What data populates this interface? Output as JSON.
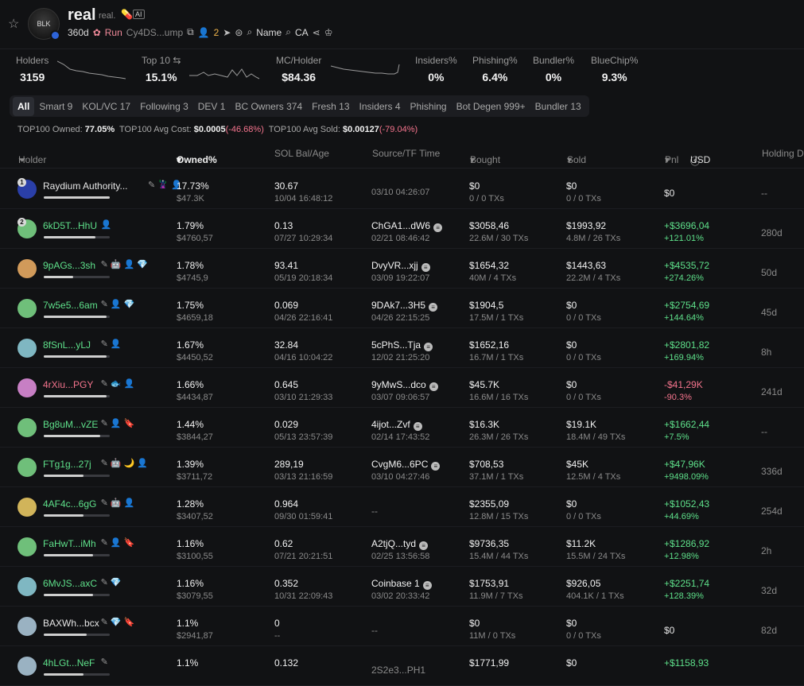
{
  "header": {
    "name": "real",
    "sub": "real.",
    "ai_badge": "AI",
    "age": "360d",
    "run": "Run",
    "ca": "Cy4DS...ump",
    "holders_count": "2",
    "name_label": "Name",
    "ca_label": "CA"
  },
  "stats": [
    {
      "label": "Holders",
      "value": "3159"
    },
    {
      "label": "Top 10",
      "value": "15.1%"
    },
    {
      "label": "MC/Holder",
      "value": "$84.36"
    },
    {
      "label": "Insiders%",
      "value": "0%"
    },
    {
      "label": "Phishing%",
      "value": "6.4%"
    },
    {
      "label": "Bundler%",
      "value": "0%"
    },
    {
      "label": "BlueChip%",
      "value": "9.3%"
    }
  ],
  "tabs": [
    "All",
    "Smart 9",
    "KOL/VC 17",
    "Following 3",
    "DEV 1",
    "BC Owners 374",
    "Fresh 13",
    "Insiders 4",
    "Phishing",
    "Bot Degen 999+",
    "Bundler 13"
  ],
  "summary": {
    "owned_label": "TOP100 Owned:",
    "owned": "77.05%",
    "cost_label": "TOP100 Avg Cost:",
    "cost": "$0.0005",
    "cost_chg": "(-46.68%)",
    "sold_label": "TOP100 Avg Sold:",
    "sold": "$0.00127",
    "sold_chg": "(-79.04%)"
  },
  "columns": {
    "holder": "Holder",
    "owned": "Owned%",
    "sol": "SOL Bal/Age",
    "source": "Source/TF Time",
    "bought": "Bought",
    "sold": "Sold",
    "pnl": "Pnl",
    "usd": "USD",
    "holding": "Holding Du"
  },
  "colors": {
    "green": "#5ee08a",
    "red": "#f4748d",
    "bg": "#111214"
  },
  "rows": [
    {
      "rank": "1",
      "name": "Raydium Authority...",
      "name_color": "w",
      "bar": 1.0,
      "avatar": "#2a3fa8",
      "badges": "✎ 🦹 👤",
      "owned": "17.73%",
      "owned_usd": "$47.3K",
      "sol": "30.67",
      "age": "10/04 16:48:12",
      "source": "",
      "src_time": "03/10 04:26:07",
      "bought": "$0",
      "bought_tx": "0 / 0 TXs",
      "sold": "$0",
      "sold_tx": "0 / 0 TXs",
      "pnl": "$0",
      "pnl_pct": "",
      "pnl_color": "w",
      "hold": "--"
    },
    {
      "rank": "2",
      "name": "6kD5T...HhU",
      "name_color": "g",
      "bar": 0.78,
      "avatar": "#6fbf7a",
      "badges": "👤",
      "owned": "1.79%",
      "owned_usd": "$4760,57",
      "sol": "0.13",
      "age": "07/27 10:29:34",
      "source": "ChGA1...dW6",
      "src_time": "02/21 08:46:42",
      "bought": "$3058,46",
      "bought_tx": "22.6M / 30 TXs",
      "sold": "$1993,92",
      "sold_tx": "4.8M / 26 TXs",
      "pnl": "+$3696,04",
      "pnl_pct": "+121.01%",
      "pnl_color": "g",
      "hold": "280d"
    },
    {
      "rank": "",
      "name": "9pAGs...3sh",
      "name_color": "g",
      "bar": 0.45,
      "avatar": "#d19a5a",
      "badges": "✎ 🤖 👤 💎",
      "owned": "1.78%",
      "owned_usd": "$4745,9",
      "sol": "93.41",
      "age": "05/19 20:18:34",
      "source": "DvyVR...xjj",
      "src_time": "03/09 19:22:07",
      "bought": "$1654,32",
      "bought_tx": "40M / 4 TXs",
      "sold": "$1443,63",
      "sold_tx": "22.2M / 4 TXs",
      "pnl": "+$4535,72",
      "pnl_pct": "+274.26%",
      "pnl_color": "g",
      "hold": "50d"
    },
    {
      "rank": "",
      "name": "7w5e5...6am",
      "name_color": "g",
      "bar": 0.95,
      "avatar": "#6fbf7a",
      "badges": "✎ 👤 💎",
      "owned": "1.75%",
      "owned_usd": "$4659,18",
      "sol": "0.069",
      "age": "04/26 22:16:41",
      "source": "9DAk7...3H5",
      "src_time": "04/26 22:15:25",
      "bought": "$1904,5",
      "bought_tx": "17.5M / 1 TXs",
      "sold": "$0",
      "sold_tx": "0 / 0 TXs",
      "pnl": "+$2754,69",
      "pnl_pct": "+144.64%",
      "pnl_color": "g",
      "hold": "45d"
    },
    {
      "rank": "",
      "name": "8fSnL...yLJ",
      "name_color": "g",
      "bar": 0.95,
      "avatar": "#7fb7c2",
      "badges": "✎   👤",
      "owned": "1.67%",
      "owned_usd": "$4450,52",
      "sol": "32.84",
      "age": "04/16 10:04:22",
      "source": "5cPhS...Tja",
      "src_time": "12/02 21:25:20",
      "bought": "$1652,16",
      "bought_tx": "16.7M / 1 TXs",
      "sold": "$0",
      "sold_tx": "0 / 0 TXs",
      "pnl": "+$2801,82",
      "pnl_pct": "+169.94%",
      "pnl_color": "g",
      "hold": "8h"
    },
    {
      "rank": "",
      "name": "4rXiu...PGY",
      "name_color": "p",
      "bar": 0.95,
      "avatar": "#c77fc4",
      "badges": "✎  🐟 👤",
      "owned": "1.66%",
      "owned_usd": "$4434,87",
      "sol": "0.645",
      "age": "03/10 21:29:33",
      "source": "9yMwS...dco",
      "src_time": "03/07 09:06:57",
      "bought": "$45.7K",
      "bought_tx": "16.6M / 16 TXs",
      "sold": "$0",
      "sold_tx": "0 / 0 TXs",
      "pnl": "-$41,29K",
      "pnl_pct": "-90.3%",
      "pnl_color": "r",
      "hold": "241d"
    },
    {
      "rank": "",
      "name": "Bg8uM...vZE",
      "name_color": "g",
      "bar": 0.85,
      "avatar": "#6fbf7a",
      "badges": "✎ 👤 🔖",
      "owned": "1.44%",
      "owned_usd": "$3844,27",
      "sol": "0.029",
      "age": "05/13 23:57:39",
      "source": "4ijot...Zvf",
      "src_time": "02/14 17:43:52",
      "bought": "$16.3K",
      "bought_tx": "26.3M / 26 TXs",
      "sold": "$19.1K",
      "sold_tx": "18.4M / 49 TXs",
      "pnl": "+$1662,44",
      "pnl_pct": "+7.5%",
      "pnl_color": "g",
      "hold": "--"
    },
    {
      "rank": "",
      "name": "FTg1g...27j",
      "name_color": "g",
      "bar": 0.6,
      "avatar": "#6fbf7a",
      "badges": "✎  🤖 🌙 👤",
      "owned": "1.39%",
      "owned_usd": "$3711,72",
      "sol": "289,19",
      "age": "03/13 21:16:59",
      "source": "CvgM6...6PC",
      "src_time": "03/10 04:27:46",
      "bought": "$708,53",
      "bought_tx": "37.1M / 1 TXs",
      "sold": "$45K",
      "sold_tx": "12.5M / 4 TXs",
      "pnl": "+$47,96K",
      "pnl_pct": "+9498.09%",
      "pnl_color": "g",
      "hold": "336d"
    },
    {
      "rank": "",
      "name": "4AF4c...6gG",
      "name_color": "g",
      "bar": 0.6,
      "avatar": "#d1b45a",
      "badges": "✎  🤖 👤",
      "owned": "1.28%",
      "owned_usd": "$3407,52",
      "sol": "0.964",
      "age": "09/30 01:59:41",
      "source": "--",
      "src_time": "",
      "bought": "$2355,09",
      "bought_tx": "12.8M / 15 TXs",
      "sold": "$0",
      "sold_tx": "0 / 0 TXs",
      "pnl": "+$1052,43",
      "pnl_pct": "+44.69%",
      "pnl_color": "g",
      "hold": "254d"
    },
    {
      "rank": "",
      "name": "FaHwT...iMh",
      "name_color": "g",
      "bar": 0.75,
      "avatar": "#6fbf7a",
      "badges": "✎  👤 🔖",
      "owned": "1.16%",
      "owned_usd": "$3100,55",
      "sol": "0.62",
      "age": "07/21 20:21:51",
      "source": "A2tjQ...tyd",
      "src_time": "02/25 13:56:58",
      "bought": "$9736,35",
      "bought_tx": "15.4M / 44 TXs",
      "sold": "$11.2K",
      "sold_tx": "15.5M / 24 TXs",
      "pnl": "+$1286,92",
      "pnl_pct": "+12.98%",
      "pnl_color": "g",
      "hold": "2h"
    },
    {
      "rank": "",
      "name": "6MvJS...axC",
      "name_color": "g",
      "bar": 0.75,
      "avatar": "#7fb7c2",
      "badges": "✎ 💎",
      "owned": "1.16%",
      "owned_usd": "$3079,55",
      "sol": "0.352",
      "age": "10/31 22:09:43",
      "source": "Coinbase 1",
      "src_time": "03/02 20:33:42",
      "bought": "$1753,91",
      "bought_tx": "11.9M / 7 TXs",
      "sold": "$926,05",
      "sold_tx": "404.1K / 1 TXs",
      "pnl": "+$2251,74",
      "pnl_pct": "+128.39%",
      "pnl_color": "g",
      "hold": "32d"
    },
    {
      "rank": "",
      "name": "BAXWh...bcx",
      "name_color": "w",
      "bar": 0.65,
      "avatar": "#9ab2c2",
      "badges": "✎ 💎 🔖",
      "owned": "1.1%",
      "owned_usd": "$2941,87",
      "sol": "0",
      "age": "--",
      "source": "--",
      "src_time": "",
      "bought": "$0",
      "bought_tx": "11M / 0 TXs",
      "sold": "$0",
      "sold_tx": "0 / 0 TXs",
      "pnl": "$0",
      "pnl_pct": "",
      "pnl_color": "w",
      "hold": "82d"
    },
    {
      "rank": "",
      "name": "4hLGt...NeF",
      "name_color": "g",
      "bar": 0.6,
      "avatar": "#9ab2c2",
      "badges": "✎",
      "owned": "1.1%",
      "owned_usd": "",
      "sol": "0.132",
      "age": "",
      "source": "2S2e3...PH1",
      "src_time": "",
      "bought": "$1771,99",
      "bought_tx": "",
      "sold": "$0",
      "sold_tx": "",
      "pnl": "+$1158,93",
      "pnl_pct": "",
      "pnl_color": "g",
      "hold": ""
    }
  ]
}
